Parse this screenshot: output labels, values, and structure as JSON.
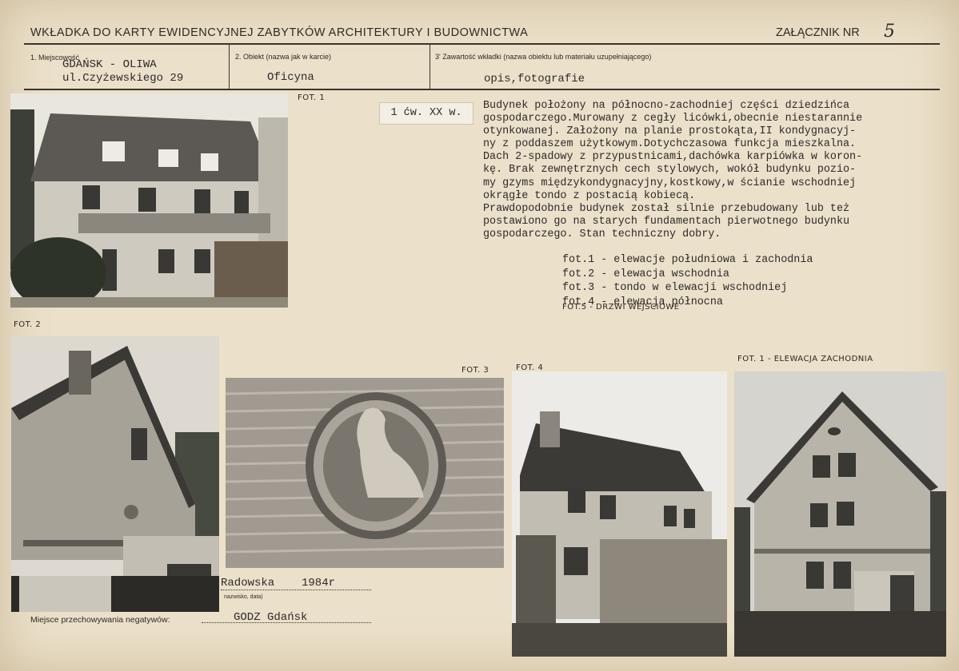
{
  "header": {
    "title": "WKŁADKA DO KARTY EWIDENCYJNEJ ZABYTKÓW ARCHITEKTURY I BUDOWNICTWA",
    "annex_label": "ZAŁĄCZNIK NR",
    "annex_number": "5"
  },
  "fields": {
    "f1_label": "1. Miejscowość",
    "f1_place": "GDAŃSK - OLIWA",
    "f1_street": "ul.Czyżewskiego 29",
    "f2_label": "2. Obiekt (nazwa jak w karcie)",
    "f2_value": "Oficyna",
    "f3_label": "3' Zawartość wkładki (nazwa obiektu lub materiału uzupełniającego)",
    "f3_value": "opis,fotografie"
  },
  "date_tag": "1 ćw. XX w.",
  "description": "Budynek położony na północno-zachodniej części dziedzińca\ngospodarczego.Murowany z cegły licówki,obecnie niestarannie\notynkowanej. Założony na planie prostokąta,II kondygnacyj-\nny z poddaszem użytkowym.Dotychczasowa funkcja mieszkalna.\nDach 2-spadowy z przypustnicami,dachówka karpiówka w koron-\nkę. Brak zewnętrznych cech stylowych, wokół budynku pozio-\nmy gzyms międzykondygnacyjny,kostkowy,w ścianie wschodniej\nokrągłe tondo z postacią kobiecą.\nPrawdopodobnie budynek został silnie przebudowany lub też\npostawiono go na starych fundamentach pierwotnego budynku\ngospodarczego. Stan techniczny dobry.",
  "captions": "fot.1 - elewacje południowa i zachodnia\nfot.2 - elewacja wschodnia\nfot.3 - tondo w elewacji wschodniej\nfot.4 - elewacja północna",
  "caption5": "fot.5 - drzwi wejściowe",
  "photo_labels": {
    "p1": "fot. 1",
    "p2": "fot. 2",
    "p3": "fot. 3",
    "p4": "fot. 4",
    "p5": "fot. 1 - elewacja zachodnia"
  },
  "footer": {
    "author": "Radowska",
    "date": "1984r",
    "author_hint": "nazwisko, data)",
    "neg_label": "Miejsce przechowywania negatywów:",
    "neg_value": "GODZ Gdańsk"
  },
  "colors": {
    "paper": "#ebe0c9",
    "ink": "#2d2a2c"
  }
}
